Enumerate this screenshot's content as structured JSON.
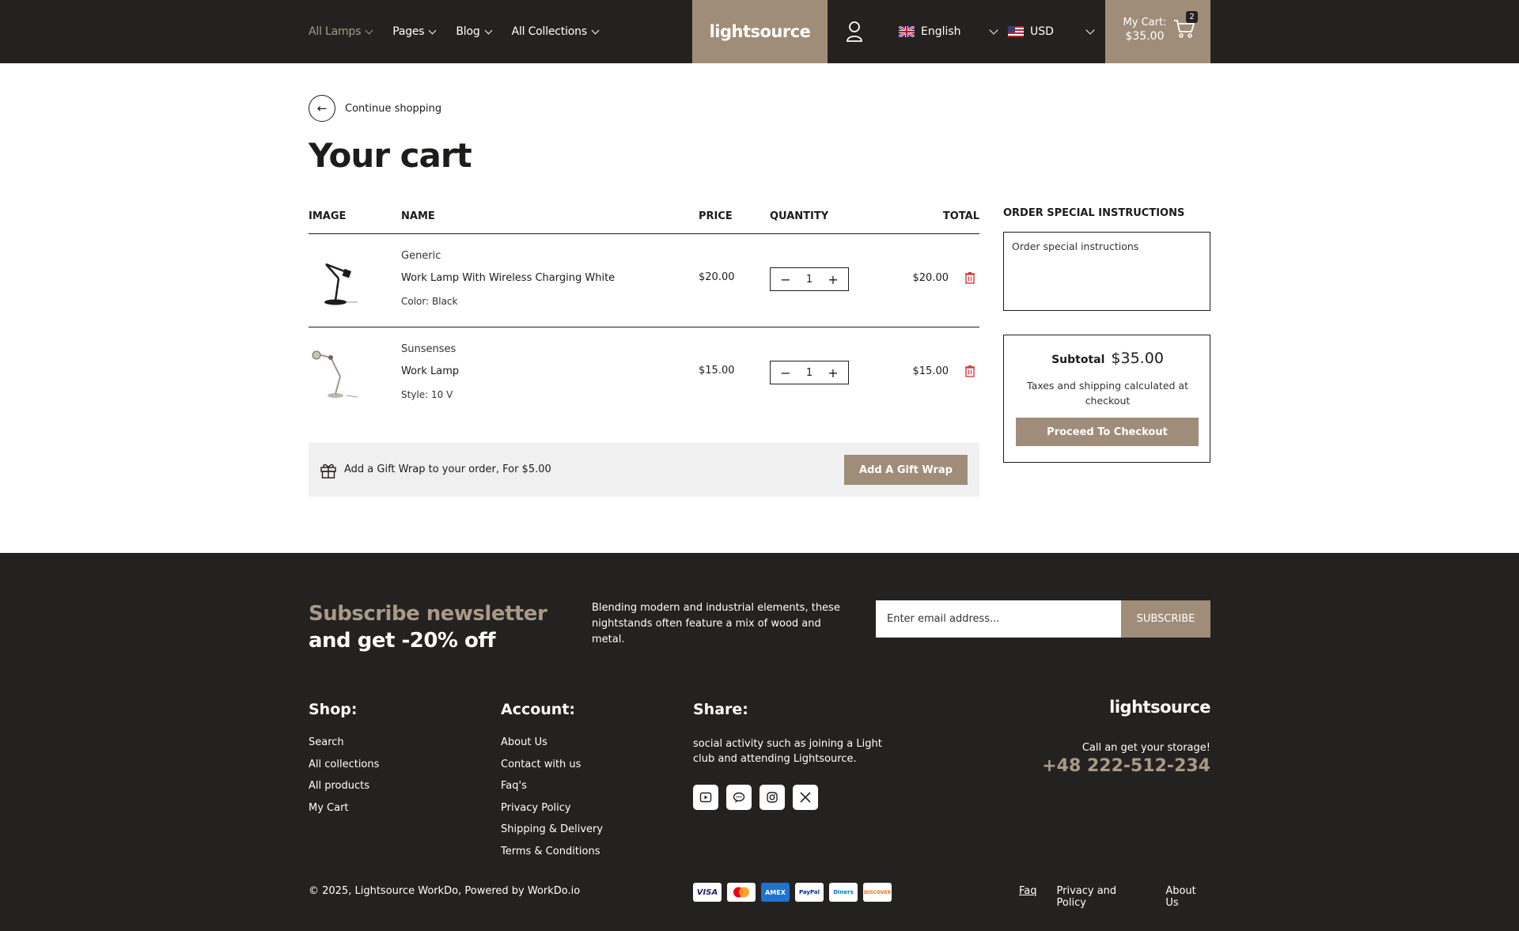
{
  "header": {
    "nav": [
      {
        "label": "All Lamps",
        "active": true
      },
      {
        "label": "Pages",
        "active": false
      },
      {
        "label": "Blog",
        "active": false
      },
      {
        "label": "All Collections",
        "active": false
      }
    ],
    "logo": "lightsource",
    "language": "English",
    "currency": "USD",
    "cart_label": "My Cart:",
    "cart_total": "$35.00",
    "cart_count": "2"
  },
  "continue_label": "Continue shopping",
  "page_title": "Your cart",
  "table": {
    "headers": {
      "image": "IMAGE",
      "name": "NAME",
      "price": "PRICE",
      "quantity": "QUANTITY",
      "total": "TOTAL"
    },
    "items": [
      {
        "vendor": "Generic",
        "name": "Work Lamp With Wireless Charging White",
        "variant_label": "Color:",
        "variant_value": "Black",
        "price": "$20.00",
        "quantity": "1",
        "total": "$20.00"
      },
      {
        "vendor": "Sunsenses",
        "name": "Work Lamp",
        "variant_label": "Style:",
        "variant_value": "10 V",
        "price": "$15.00",
        "quantity": "1",
        "total": "$15.00"
      }
    ]
  },
  "gift": {
    "text": "Add a Gift Wrap to your order, For $5.00",
    "button": "Add A Gift Wrap"
  },
  "instructions": {
    "label": "ORDER SPECIAL INSTRUCTIONS",
    "placeholder": "Order special instructions"
  },
  "summary": {
    "subtotal_label": "Subtotal",
    "subtotal_value": "$35.00",
    "tax_note": "Taxes and shipping calculated at checkout",
    "checkout_button": "Proceed To Checkout"
  },
  "footer": {
    "newsletter_accent": "Subscribe newsletter",
    "newsletter_rest": " and get -20% off",
    "newsletter_desc": "Blending modern and industrial elements, these nightstands often feature a mix of wood and metal.",
    "email_placeholder": "Enter email address...",
    "subscribe_button": "SUBSCRIBE",
    "shop_title": "Shop:",
    "shop_links": [
      "Search",
      "All collections",
      "All products",
      "My Cart"
    ],
    "account_title": "Account:",
    "account_links": [
      "About Us",
      "Contact with us",
      "Faq's",
      "Privacy Policy",
      "Shipping & Delivery",
      "Terms & Conditions"
    ],
    "share_title": "Share:",
    "share_text": "social activity such as joining a Light club and attending Lightsource.",
    "logo": "lightsource",
    "call_label": "Call an get your storage!",
    "phone": "+48 222-512-234",
    "copyright": "© 2025, Lightsource WorkDo, Powered by WorkDo.io",
    "payments": [
      "VISA",
      "MC",
      "AMEX",
      "PayPal",
      "Diners",
      "DISCOVER"
    ],
    "bottom_links": [
      "Faq",
      "Privacy and Policy",
      "About Us"
    ]
  },
  "colors": {
    "accent": "#a08d79",
    "dark": "#242220",
    "danger": "#d9383a"
  }
}
